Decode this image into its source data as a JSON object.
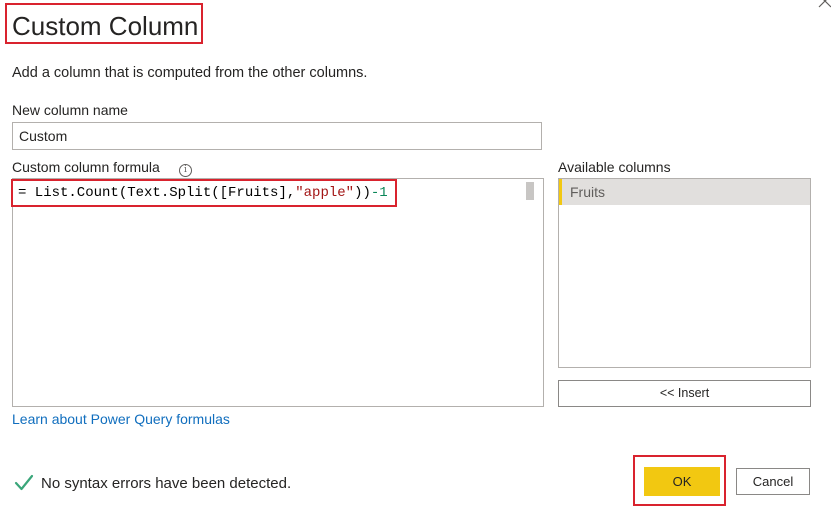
{
  "dialog": {
    "title": "Custom Column",
    "subtitle": "Add a column that is computed from the other columns."
  },
  "column_name": {
    "label": "New column name",
    "value": "Custom"
  },
  "formula": {
    "label": "Custom column formula",
    "prefix": "= List.Count(Text.Split([Fruits],",
    "string": "\"apple\"",
    "middle": "))",
    "number": "-1"
  },
  "available_columns": {
    "label": "Available columns",
    "items": [
      "Fruits"
    ],
    "insert_label": "<< Insert"
  },
  "learn_link": "Learn about Power Query formulas",
  "status": {
    "text": "No syntax errors have been detected."
  },
  "buttons": {
    "ok": "OK",
    "cancel": "Cancel"
  },
  "colors": {
    "accent": "#f2c811",
    "highlight_border": "#d9232e",
    "link": "#106ebe",
    "success": "#3aa67a"
  },
  "icons": {
    "close": "close-icon",
    "info": "info-icon",
    "check": "check-icon"
  }
}
